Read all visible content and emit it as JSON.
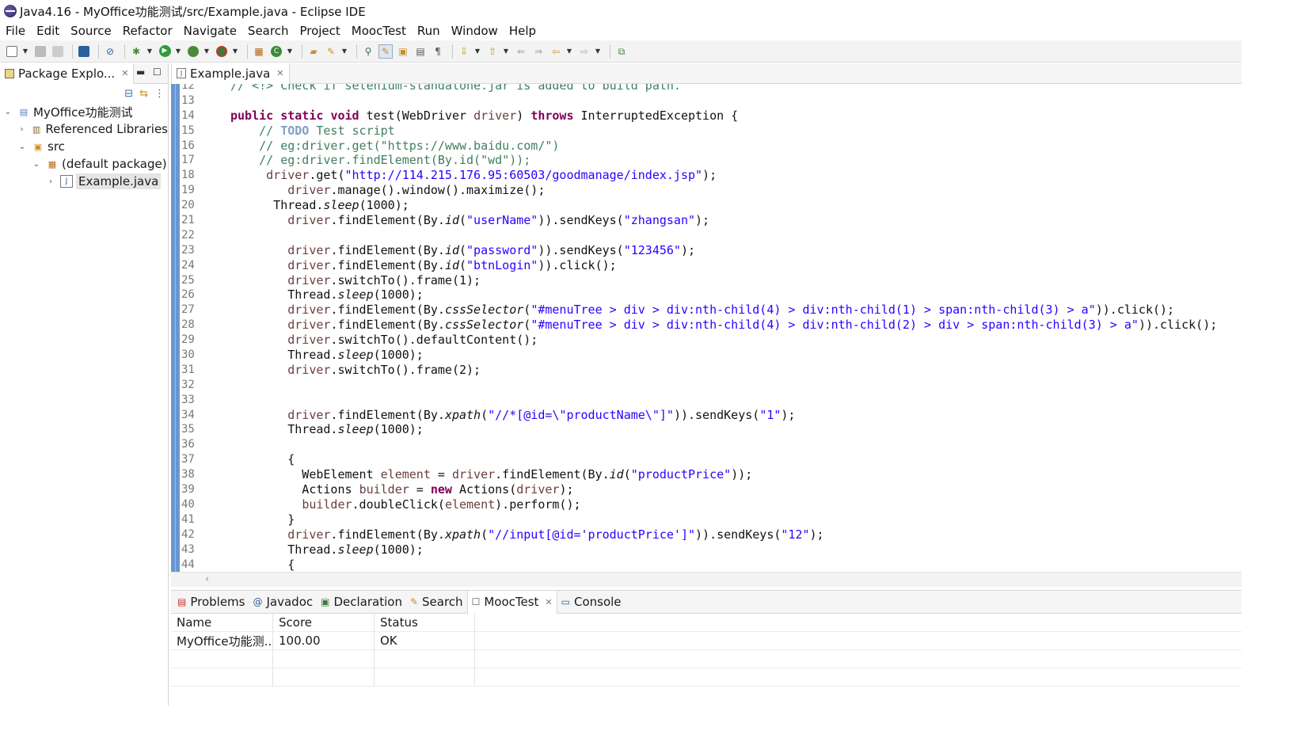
{
  "window": {
    "title": "Java4.16 - MyOffice功能测试/src/Example.java - Eclipse IDE"
  },
  "menu": [
    "File",
    "Edit",
    "Source",
    "Refactor",
    "Navigate",
    "Search",
    "Project",
    "MoocTest",
    "Run",
    "Window",
    "Help"
  ],
  "left_panel": {
    "tab_label": "Package Explo...",
    "tree": {
      "project": "MyOffice功能测试",
      "referenced_libraries": "Referenced Libraries",
      "src": "src",
      "package": "(default package)",
      "file": "Example.java"
    }
  },
  "editor": {
    "tab_label": "Example.java",
    "lines": [
      {
        "n": "12",
        "html": "<span class=\"cm\">// &lt;!&gt; Check if selenium-standalone.jar is added to build path.</span>"
      },
      {
        "n": "13",
        "html": ""
      },
      {
        "n": "14",
        "html": "<span class=\"kw\">public</span> <span class=\"kw\">static</span> <span class=\"kw\">void</span> test(WebDriver <span class=\"var\">driver</span>) <span class=\"kw\">throws</span> InterruptedException {"
      },
      {
        "n": "15",
        "html": "    <span class=\"cm\">// <span class=\"todo\">TODO</span> Test script</span>"
      },
      {
        "n": "16",
        "html": "    <span class=\"cm\">// eg:driver.get(\"https://www.baidu.com/\")</span>"
      },
      {
        "n": "17",
        "html": "    <span class=\"cm\">// eg:driver.findElement(By.id(\"wd\"));</span>"
      },
      {
        "n": "18",
        "html": "     <span class=\"var\">driver</span>.get(<span class=\"str\">\"http://114.215.176.95:60503/goodmanage/index.jsp\"</span>);"
      },
      {
        "n": "19",
        "html": "        <span class=\"var\">driver</span>.manage().window().maximize();"
      },
      {
        "n": "20",
        "html": "      Thread.<span class=\"it\">sleep</span>(1000);"
      },
      {
        "n": "21",
        "html": "        <span class=\"var\">driver</span>.findElement(By.<span class=\"it\">id</span>(<span class=\"str\">\"userName\"</span>)).sendKeys(<span class=\"str\">\"zhangsan\"</span>);"
      },
      {
        "n": "22",
        "html": ""
      },
      {
        "n": "23",
        "html": "        <span class=\"var\">driver</span>.findElement(By.<span class=\"it\">id</span>(<span class=\"str\">\"password\"</span>)).sendKeys(<span class=\"str\">\"123456\"</span>);"
      },
      {
        "n": "24",
        "html": "        <span class=\"var\">driver</span>.findElement(By.<span class=\"it\">id</span>(<span class=\"str\">\"btnLogin\"</span>)).click();"
      },
      {
        "n": "25",
        "html": "        <span class=\"var\">driver</span>.switchTo().frame(1);"
      },
      {
        "n": "26",
        "html": "        Thread.<span class=\"it\">sleep</span>(1000);"
      },
      {
        "n": "27",
        "html": "        <span class=\"var\">driver</span>.findElement(By.<span class=\"it\">cssSelector</span>(<span class=\"str\">\"#menuTree &gt; div &gt; div:nth-child(4) &gt; div:nth-child(1) &gt; span:nth-child(3) &gt; a\"</span>)).click();"
      },
      {
        "n": "28",
        "html": "        <span class=\"var\">driver</span>.findElement(By.<span class=\"it\">cssSelector</span>(<span class=\"str\">\"#menuTree &gt; div &gt; div:nth-child(4) &gt; div:nth-child(2) &gt; div &gt; span:nth-child(3) &gt; a\"</span>)).click();"
      },
      {
        "n": "29",
        "html": "        <span class=\"var\">driver</span>.switchTo().defaultContent();"
      },
      {
        "n": "30",
        "html": "        Thread.<span class=\"it\">sleep</span>(1000);"
      },
      {
        "n": "31",
        "html": "        <span class=\"var\">driver</span>.switchTo().frame(2);"
      },
      {
        "n": "32",
        "html": ""
      },
      {
        "n": "33",
        "html": ""
      },
      {
        "n": "34",
        "html": "        <span class=\"var\">driver</span>.findElement(By.<span class=\"it\">xpath</span>(<span class=\"str\">\"//*[@id=\\\"productName\\\"]\"</span>)).sendKeys(<span class=\"str\">\"1\"</span>);"
      },
      {
        "n": "35",
        "html": "        Thread.<span class=\"it\">sleep</span>(1000);"
      },
      {
        "n": "36",
        "html": ""
      },
      {
        "n": "37",
        "html": "        {"
      },
      {
        "n": "38",
        "html": "          WebElement <span class=\"var\">element</span> = <span class=\"var\">driver</span>.findElement(By.<span class=\"it\">id</span>(<span class=\"str\">\"productPrice\"</span>));"
      },
      {
        "n": "39",
        "html": "          Actions <span class=\"var\">builder</span> = <span class=\"kw\">new</span> Actions(<span class=\"var\">driver</span>);"
      },
      {
        "n": "40",
        "html": "          <span class=\"var\">builder</span>.doubleClick(<span class=\"var\">element</span>).perform();"
      },
      {
        "n": "41",
        "html": "        }"
      },
      {
        "n": "42",
        "html": "        <span class=\"var\">driver</span>.findElement(By.<span class=\"it\">xpath</span>(<span class=\"str\">\"//input[@id='productPrice']\"</span>)).sendKeys(<span class=\"str\">\"12\"</span>);"
      },
      {
        "n": "43",
        "html": "        Thread.<span class=\"it\">sleep</span>(1000);"
      },
      {
        "n": "44",
        "html": "        {"
      }
    ]
  },
  "bottom_panel": {
    "tabs": [
      {
        "label": "Problems",
        "icon": "problems-icon"
      },
      {
        "label": "Javadoc",
        "icon": "javadoc-icon"
      },
      {
        "label": "Declaration",
        "icon": "declaration-icon"
      },
      {
        "label": "Search",
        "icon": "search-icon"
      },
      {
        "label": "MoocTest",
        "icon": "mooctest-icon"
      },
      {
        "label": "Console",
        "icon": "console-icon"
      }
    ],
    "table": {
      "headers": [
        "Name",
        "Score",
        "Status"
      ],
      "rows": [
        [
          "MyOffice功能测...",
          "100.00",
          "OK"
        ]
      ]
    }
  },
  "colors": {
    "keyword": "#7f0055",
    "comment": "#3f7f5f",
    "string": "#2a00ff",
    "ruler": "#6a96cf"
  }
}
